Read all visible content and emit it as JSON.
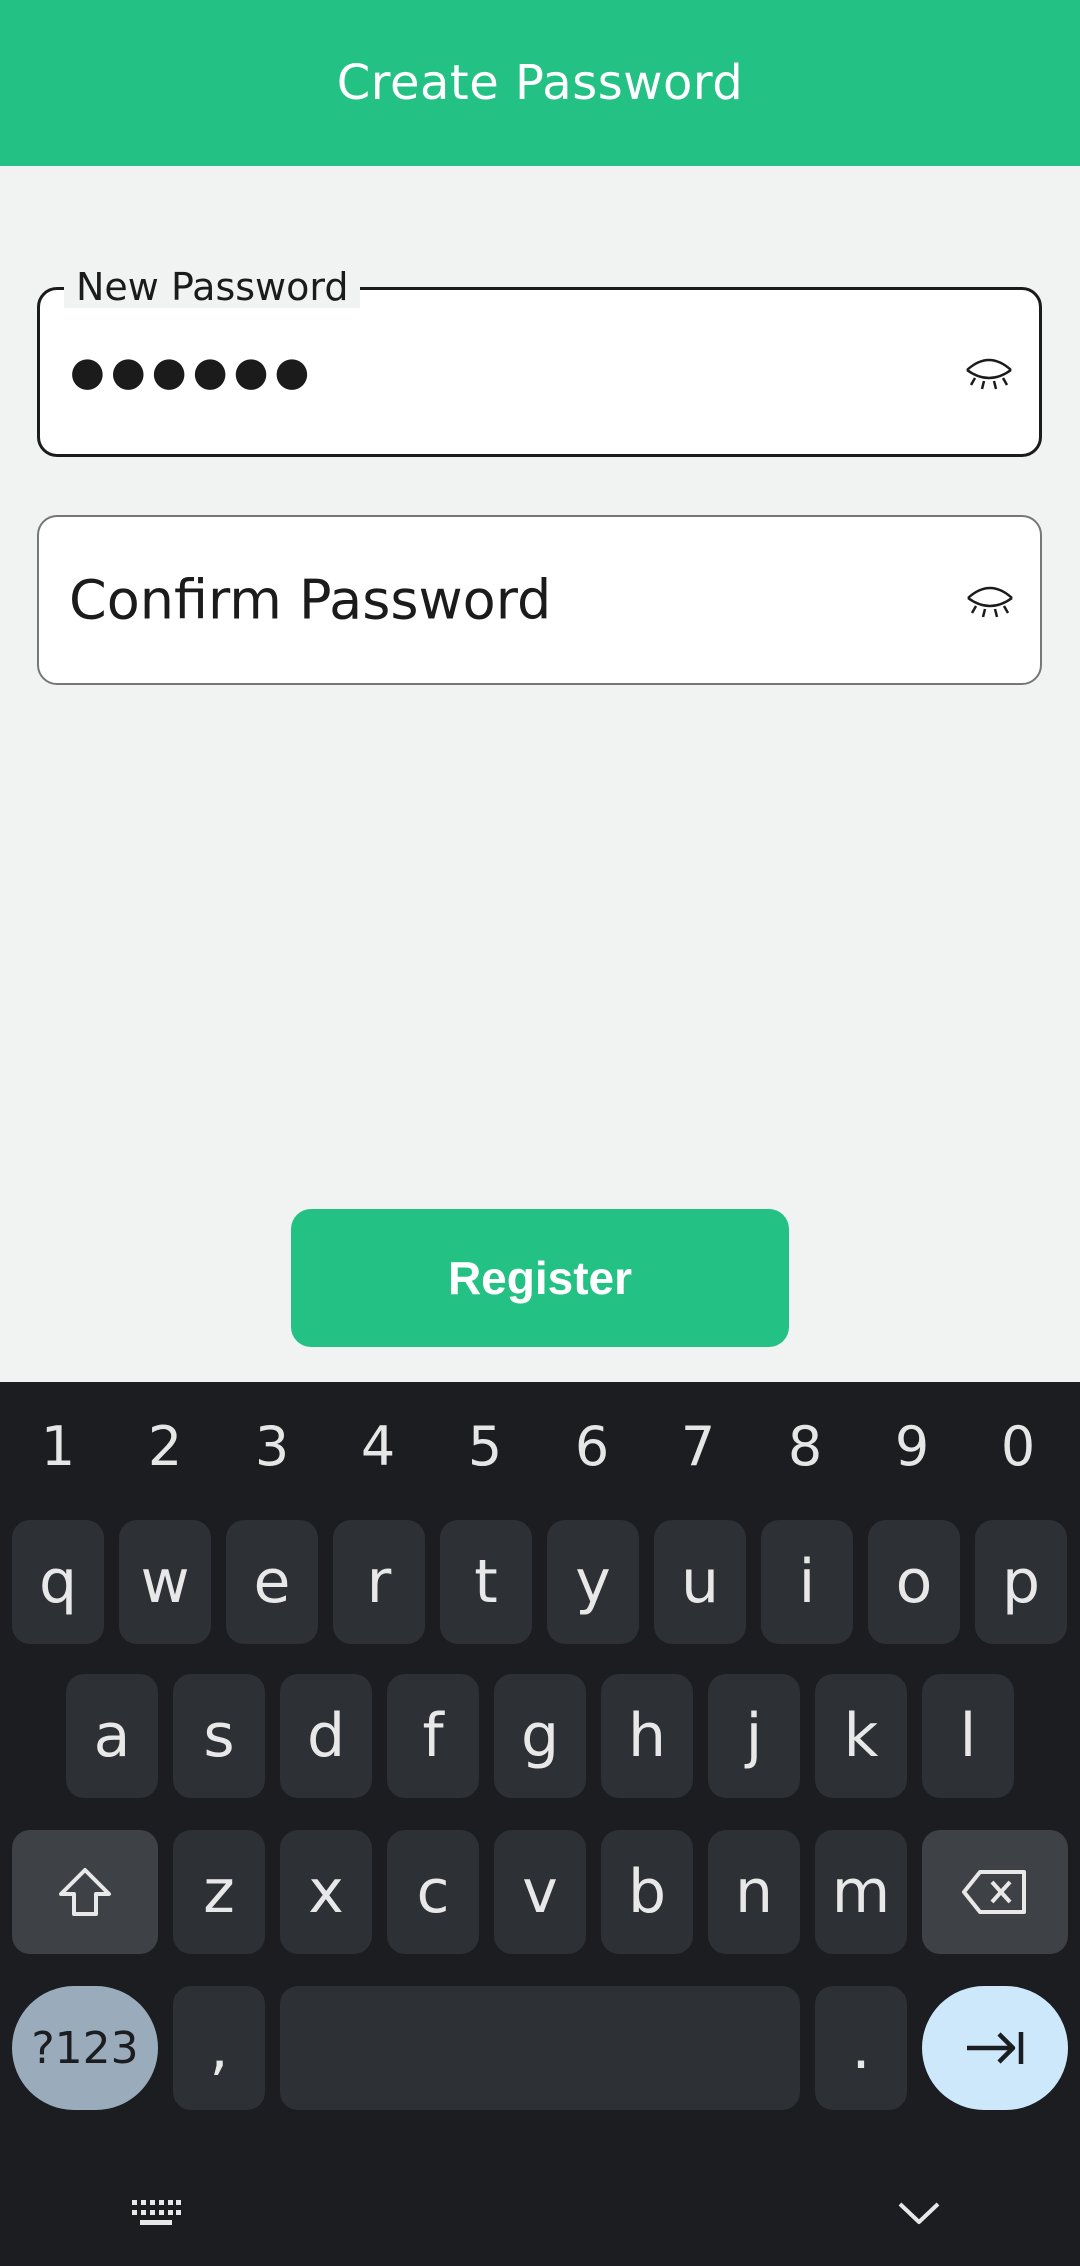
{
  "header": {
    "title": "Create Password"
  },
  "form": {
    "new_password": {
      "label": "New Password",
      "value": "●●●●●●"
    },
    "confirm_password": {
      "placeholder": "Confirm Password"
    },
    "register_label": "Register"
  },
  "keyboard": {
    "numbers": [
      "1",
      "2",
      "3",
      "4",
      "5",
      "6",
      "7",
      "8",
      "9",
      "0"
    ],
    "row1": [
      "q",
      "w",
      "e",
      "r",
      "t",
      "y",
      "u",
      "i",
      "o",
      "p"
    ],
    "row2": [
      "a",
      "s",
      "d",
      "f",
      "g",
      "h",
      "j",
      "k",
      "l"
    ],
    "row3": [
      "z",
      "x",
      "c",
      "v",
      "b",
      "n",
      "m"
    ],
    "mode_label": "?123",
    "comma": ",",
    "period": "."
  },
  "colors": {
    "accent": "#24c185",
    "keyboard_bg": "#1b1d20"
  }
}
